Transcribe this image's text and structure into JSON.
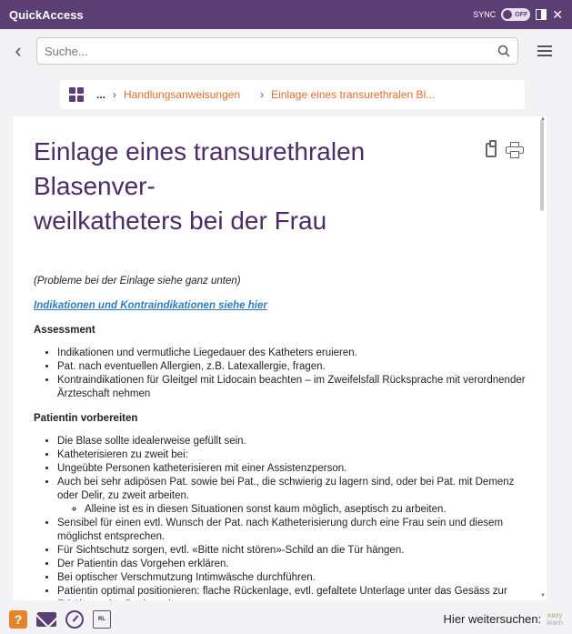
{
  "window": {
    "title": "QuickAccess",
    "sync_label": "SYNC",
    "toggle_state": "OFF"
  },
  "search": {
    "placeholder": "Suche..."
  },
  "breadcrumb": {
    "ellipsis": "...",
    "items": [
      "Handlungsanweisungen",
      "Einlage eines transurethralen Bl..."
    ]
  },
  "doc": {
    "title": "Einlage eines transurethralen Blasenver-weilkatheters bei der Frau",
    "title_line1": "Einlage eines transurethralen Blasenver-",
    "title_line2": "weilkatheters bei der Frau",
    "note": "(Probleme bei der Einlage siehe ganz unten)",
    "link": "Indikationen und Kontraindikationen siehe hier",
    "sections": [
      {
        "heading": "Assessment",
        "items": [
          "Indikationen und vermutliche Liegedauer des Katheters eruieren.",
          "Pat. nach eventuellen Allergien, z.B. Latexallergie, fragen.",
          "Kontraindikationen für Gleitgel mit Lidocain beachten – im Zweifelsfall Rücksprache mit verordnender Ärzteschaft nehmen"
        ]
      },
      {
        "heading": "Patientin vorbereiten",
        "items": [
          "Die Blase sollte idealerweise gefüllt sein.",
          "Katheterisieren zu zweit bei:",
          "Ungeübte Personen katheterisieren mit einer Assistenzperson.",
          "Auch bei sehr adipösen Pat. sowie bei Pat., die schwierig zu lagern sind, oder bei Pat. mit Demenz oder Delir, zu zweit arbeiten.",
          "Sensibel für einen evtl. Wunsch der Pat. nach Katheterisierung durch eine Frau sein und diesem möglichst entsprechen.",
          "Für Sichtschutz sorgen, evtl. «Bitte nicht stören»-Schild an die Tür hängen.",
          "Der Patientin das Vorgehen erklären.",
          "Bei optischer Verschmutzung Intimwäsche durchführen.",
          "Patientin optimal positionieren: flache Rückenlage, evtl. gefaltete Unterlage unter das Gesäss zur Erhöhung des Beckens legen"
        ],
        "sub_item": "Alleine ist es in diesen Situationen sonst kaum möglich, aseptisch zu arbeiten."
      }
    ]
  },
  "footer": {
    "search_label": "Hier weitersuchen:",
    "brand_line1": "easy",
    "brand_line2": "learn",
    "rl_label": "RL"
  },
  "colors": {
    "brand": "#5b3f74",
    "accent": "#e06d2c",
    "link": "#2f7dc1"
  }
}
